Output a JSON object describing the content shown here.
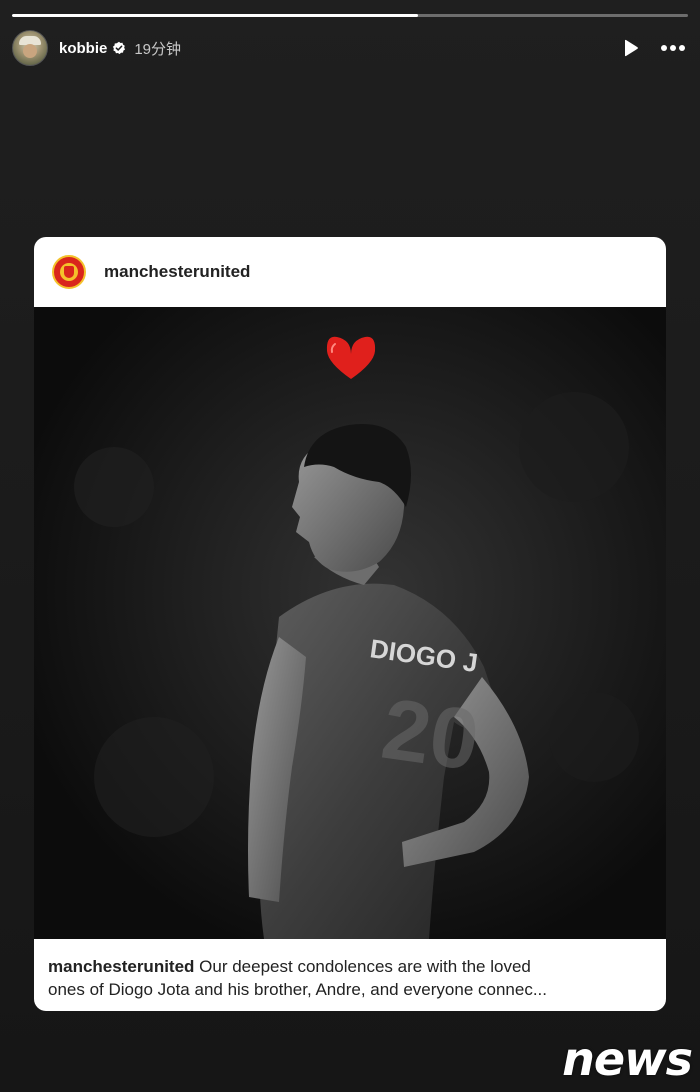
{
  "story": {
    "progress_fraction": 0.6
  },
  "header": {
    "username": "kobbie",
    "verified_icon": "verified-badge-icon",
    "timestamp": "19分钟",
    "play_icon": "play-icon",
    "more_icon": "more-options-icon"
  },
  "post": {
    "account": "manchesterunited",
    "crest_icon": "manchester-united-crest-icon",
    "image_overlay_icon": "red-heart-icon",
    "jersey_name": "DIOGO J",
    "caption_user": "manchesterunited",
    "caption_text_line1": " Our deepest condolences are with the loved",
    "caption_text_line2": "ones of Diogo Jota and his brother, Andre, and everyone connec..."
  },
  "watermark": {
    "text": "news"
  },
  "colors": {
    "background": "#1c1c1c",
    "card": "#ffffff",
    "heart": "#e0201c",
    "crest_red": "#d9261c",
    "crest_gold": "#f4c22b"
  }
}
